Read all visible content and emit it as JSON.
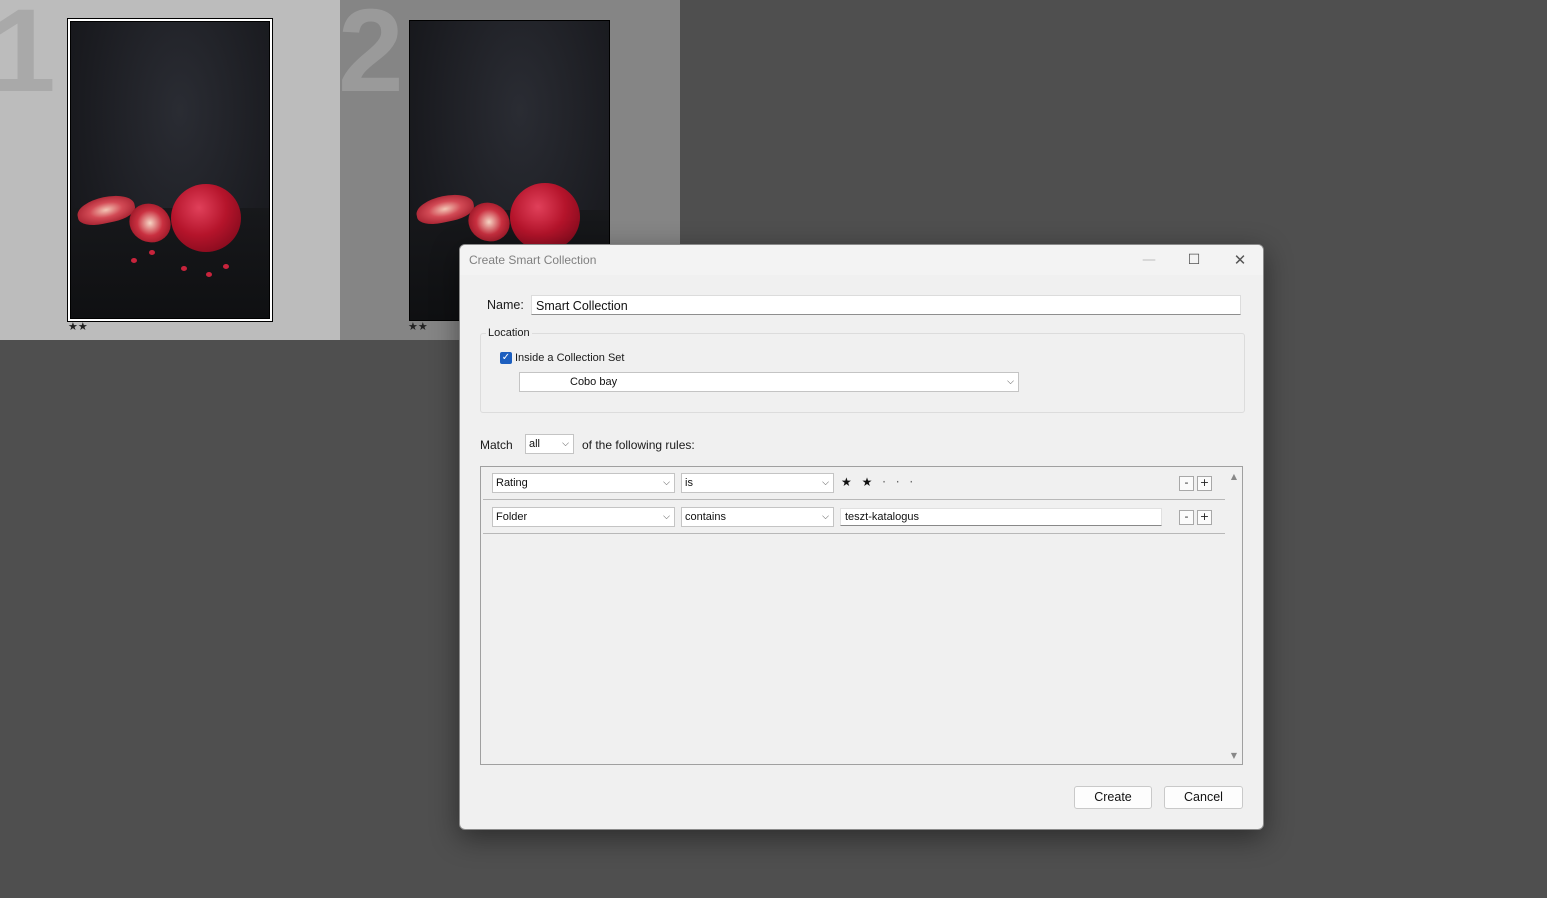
{
  "grid": {
    "cells": [
      {
        "number": "1",
        "rating_stars": "★★"
      },
      {
        "number": "2",
        "rating_stars": "★★"
      }
    ]
  },
  "dialog": {
    "title": "Create Smart Collection",
    "window_controls": {
      "minimize": "—",
      "maximize": "☐",
      "close": "✕"
    },
    "name_label": "Name:",
    "name_value": "Smart Collection",
    "location_legend": "Location",
    "inside_set_checked": true,
    "inside_set_label": "Inside a Collection Set",
    "collection_set_value": "Cobo bay",
    "match_label": "Match",
    "match_value": "all",
    "rules_label": "of the following rules:",
    "rules": [
      {
        "field": "Rating",
        "operator": "is",
        "stars_filled": "★ ★",
        "stars_empty": "· · ·"
      },
      {
        "field": "Folder",
        "operator": "contains",
        "value": "teszt-katalogus"
      }
    ],
    "rule_remove": "-",
    "rule_add": "+",
    "create_label": "Create",
    "cancel_label": "Cancel"
  }
}
